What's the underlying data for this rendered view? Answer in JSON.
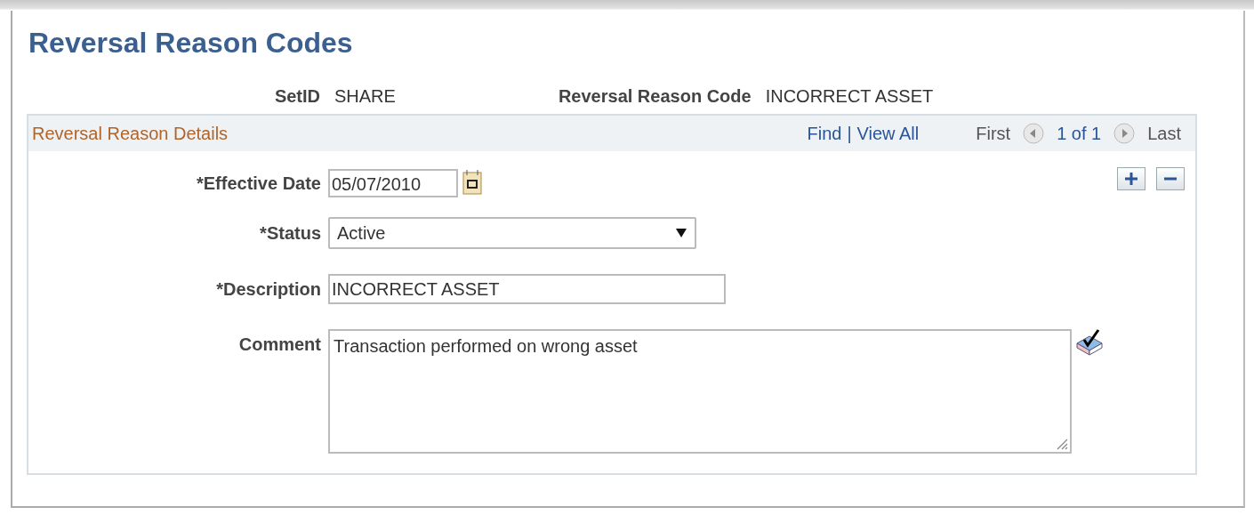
{
  "page": {
    "title": "Reversal Reason Codes"
  },
  "keys": [
    {
      "label": "SetID",
      "value": "SHARE"
    },
    {
      "label": "Reversal Reason Code",
      "value": "INCORRECT ASSET"
    }
  ],
  "group": {
    "title": "Reversal Reason Details",
    "find": "Find",
    "separator": "|",
    "view_all": "View All",
    "first": {
      "label": "First",
      "disabled": true
    },
    "counter": "1 of 1",
    "last": {
      "label": "Last",
      "disabled": true
    }
  },
  "fields": [
    {
      "kind": "date",
      "label": "*Effective Date",
      "value": "05/07/2010"
    },
    {
      "kind": "select",
      "label": "*Status",
      "value": "Active"
    },
    {
      "kind": "text",
      "label": "*Description",
      "value": "INCORRECT ASSET"
    },
    {
      "kind": "textarea",
      "label": "Comment",
      "value": "Transaction performed on wrong asset"
    }
  ]
}
